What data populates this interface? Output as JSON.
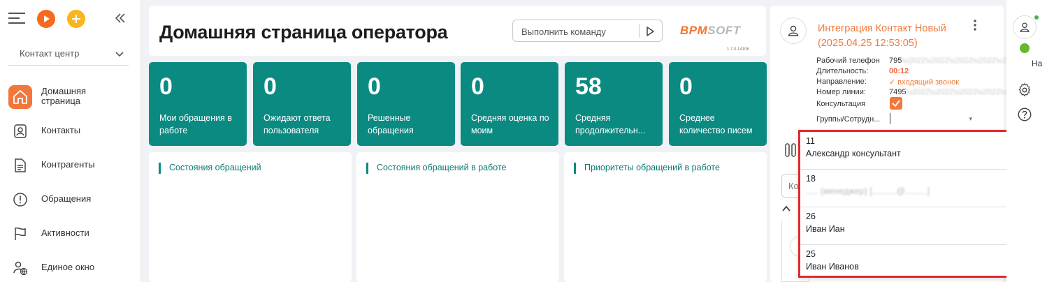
{
  "sidebar": {
    "workspace": "Контакт центр",
    "items": [
      {
        "label": "Домашняя страница",
        "active": true
      },
      {
        "label": "Контакты"
      },
      {
        "label": "Контрагенты"
      },
      {
        "label": "Обращения"
      },
      {
        "label": "Активности"
      },
      {
        "label": "Единое окно"
      }
    ]
  },
  "header": {
    "title": "Домашняя страница оператора",
    "command_placeholder": "Выполнить команду",
    "logo_accent": "BPM",
    "logo_rest": "SOFT",
    "version": "1.7.0.14106"
  },
  "tiles": [
    {
      "value": "0",
      "caption": "Мои обращения в работе"
    },
    {
      "value": "0",
      "caption": "Ожидают ответа пользователя"
    },
    {
      "value": "0",
      "caption": "Решенные обращения"
    },
    {
      "value": "0",
      "caption": "Средняя оценка по моим"
    },
    {
      "value": "58",
      "caption": "Средняя продолжительн..."
    },
    {
      "value": "0",
      "caption": "Среднее количество писем"
    }
  ],
  "widgets": [
    {
      "title": "Состояния обращений"
    },
    {
      "title": "Состояния обращений в работе"
    },
    {
      "title": "Приоритеты обращений в работе"
    }
  ],
  "call": {
    "title_line1": "Интеграция Контакт Новый",
    "title_line2": "(2025.04.25 12:53:05)",
    "phone_label": "Рабочий телефон",
    "phone_value": "795",
    "duration_label": "Длительность:",
    "duration_value": "00:12",
    "direction_label": "Направление:",
    "direction_value": "✓ входящий звонок",
    "line_label": "Номер линии:",
    "line_value": "7495",
    "consult_label": "Консультация",
    "groups_label": "Группы/Сотрудн...",
    "input_partial": "Ко"
  },
  "dropdown": {
    "items": [
      {
        "code": "11",
        "name": "Александр консультант"
      },
      {
        "code": "18",
        "name": "..... (менеджер) [..........@.........]"
      },
      {
        "code": "26",
        "name": "Иван Иан"
      },
      {
        "code": "25",
        "name": "Иван Иванов"
      }
    ]
  },
  "right_bar": {
    "status_text": "На"
  },
  "colors": {
    "accent": "#f3773b",
    "teal": "#0b8a82",
    "highlight_border": "#e3282e",
    "online": "#64b92f"
  }
}
